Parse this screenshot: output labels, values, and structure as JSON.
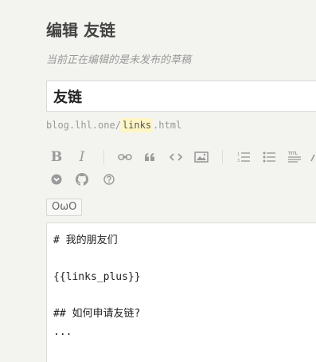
{
  "header": {
    "title": "编辑 友链",
    "draft_notice": "当前正在编辑的是未发布的草稿"
  },
  "title_field": {
    "value": "友链"
  },
  "url": {
    "prefix": "blog.lhl.one/",
    "slug": "links",
    "suffix": ".html"
  },
  "toolbar": {
    "bold": "B",
    "italic": "I",
    "more_icons": [
      "link-icon",
      "quote-icon",
      "code-icon",
      "image-icon",
      "ordered-list-icon",
      "unordered-list-icon",
      "heading-icon",
      "chevron-down-circle-icon",
      "github-icon",
      "help-icon"
    ]
  },
  "emoji_button": {
    "label": "OωO"
  },
  "editor": {
    "content": "# 我的朋友们\n\n{{links_plus}}\n\n## 如何申请友链?\n..."
  }
}
